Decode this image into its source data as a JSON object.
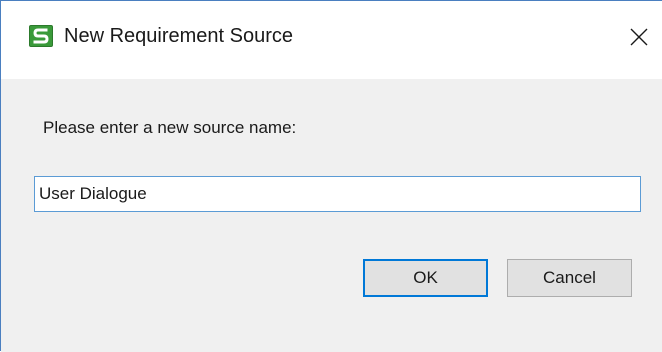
{
  "window": {
    "title": "New Requirement Source",
    "app_icon": "s-logo-icon",
    "close_icon": "close-icon"
  },
  "dialog": {
    "prompt": "Please enter a new source name:",
    "input_value": "User Dialogue",
    "ok_label": "OK",
    "cancel_label": "Cancel"
  },
  "colors": {
    "accent": "#0078d7",
    "input_border": "#5b9bd5",
    "icon_green": "#3a9a3a"
  }
}
